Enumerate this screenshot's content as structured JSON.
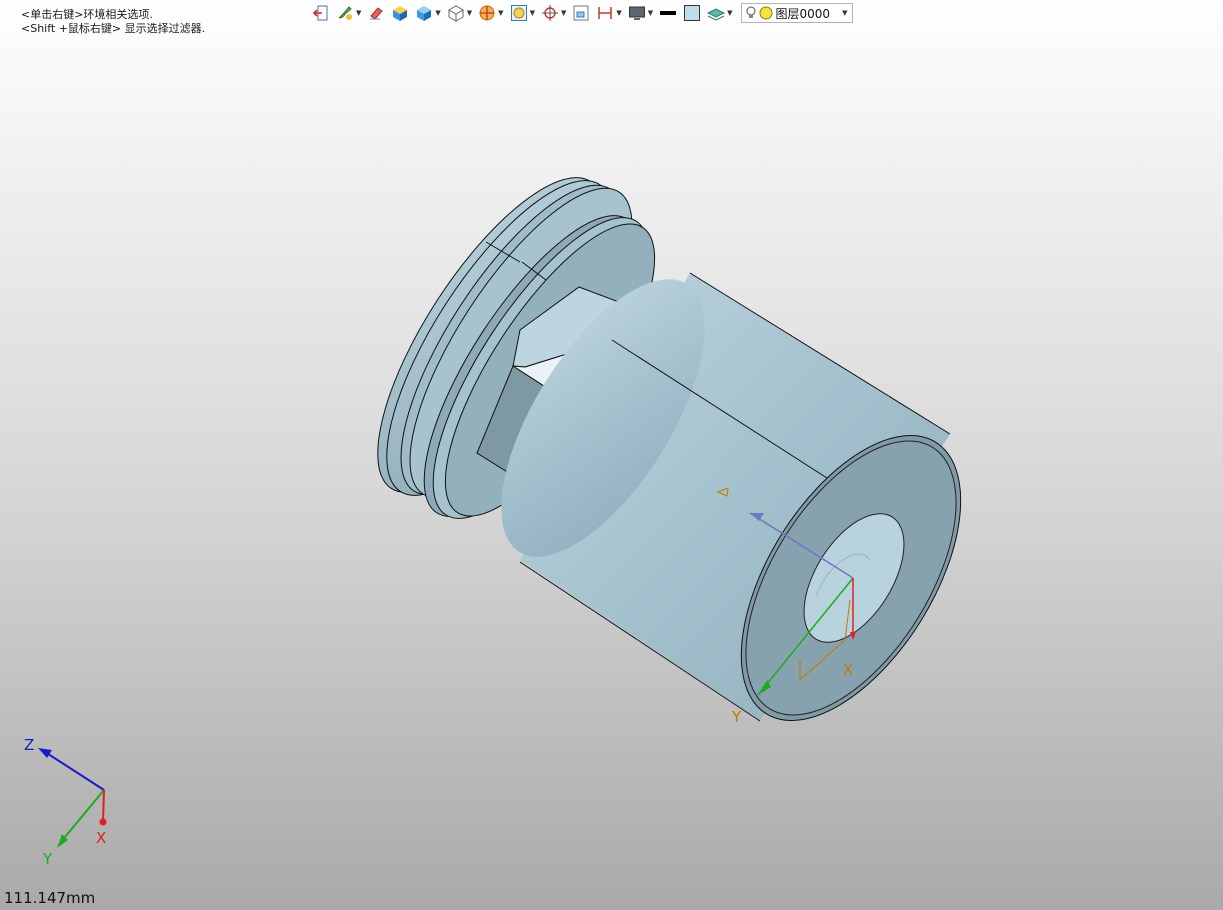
{
  "hints": {
    "line1": "<单击右键>环境相关选项.",
    "line2": "<Shift +鼠标右键> 显示选择过滤器."
  },
  "toolbar": {
    "buttons": [
      {
        "icon": "exit-icon",
        "dropdown": false
      },
      {
        "icon": "paint-brush-icon",
        "dropdown": true
      },
      {
        "icon": "eraser-icon",
        "dropdown": false
      },
      {
        "icon": "shaded-cube-icon",
        "dropdown": false
      },
      {
        "icon": "solid-cube-icon",
        "dropdown": true
      },
      {
        "icon": "wireframe-cube-icon",
        "dropdown": true
      },
      {
        "icon": "section-view-icon",
        "dropdown": true
      },
      {
        "icon": "zoom-fit-icon",
        "dropdown": true
      },
      {
        "icon": "crosshair-icon",
        "dropdown": true
      },
      {
        "icon": "frame-icon",
        "dropdown": false
      },
      {
        "icon": "dimension-icon",
        "dropdown": true
      },
      {
        "icon": "monitor-icon",
        "dropdown": true
      },
      {
        "icon": "line-style-icon",
        "dropdown": false
      },
      {
        "icon": "color-swatch-icon",
        "dropdown": false
      },
      {
        "icon": "layers-icon",
        "dropdown": true
      }
    ],
    "layer": {
      "label": "图层0000"
    }
  },
  "triad": {
    "x": "X",
    "y": "Y",
    "z": "Z"
  },
  "part_axes": {
    "x": "X",
    "y": "Y"
  },
  "status": {
    "scale": "111.147mm"
  },
  "colors": {
    "part_face": "#a9c6d3",
    "part_dark": "#7f99a4",
    "axis_x": "#e02020",
    "axis_y": "#1faa1f",
    "axis_z": "#1a1acc",
    "axis_label_orange": "#c27a00"
  }
}
